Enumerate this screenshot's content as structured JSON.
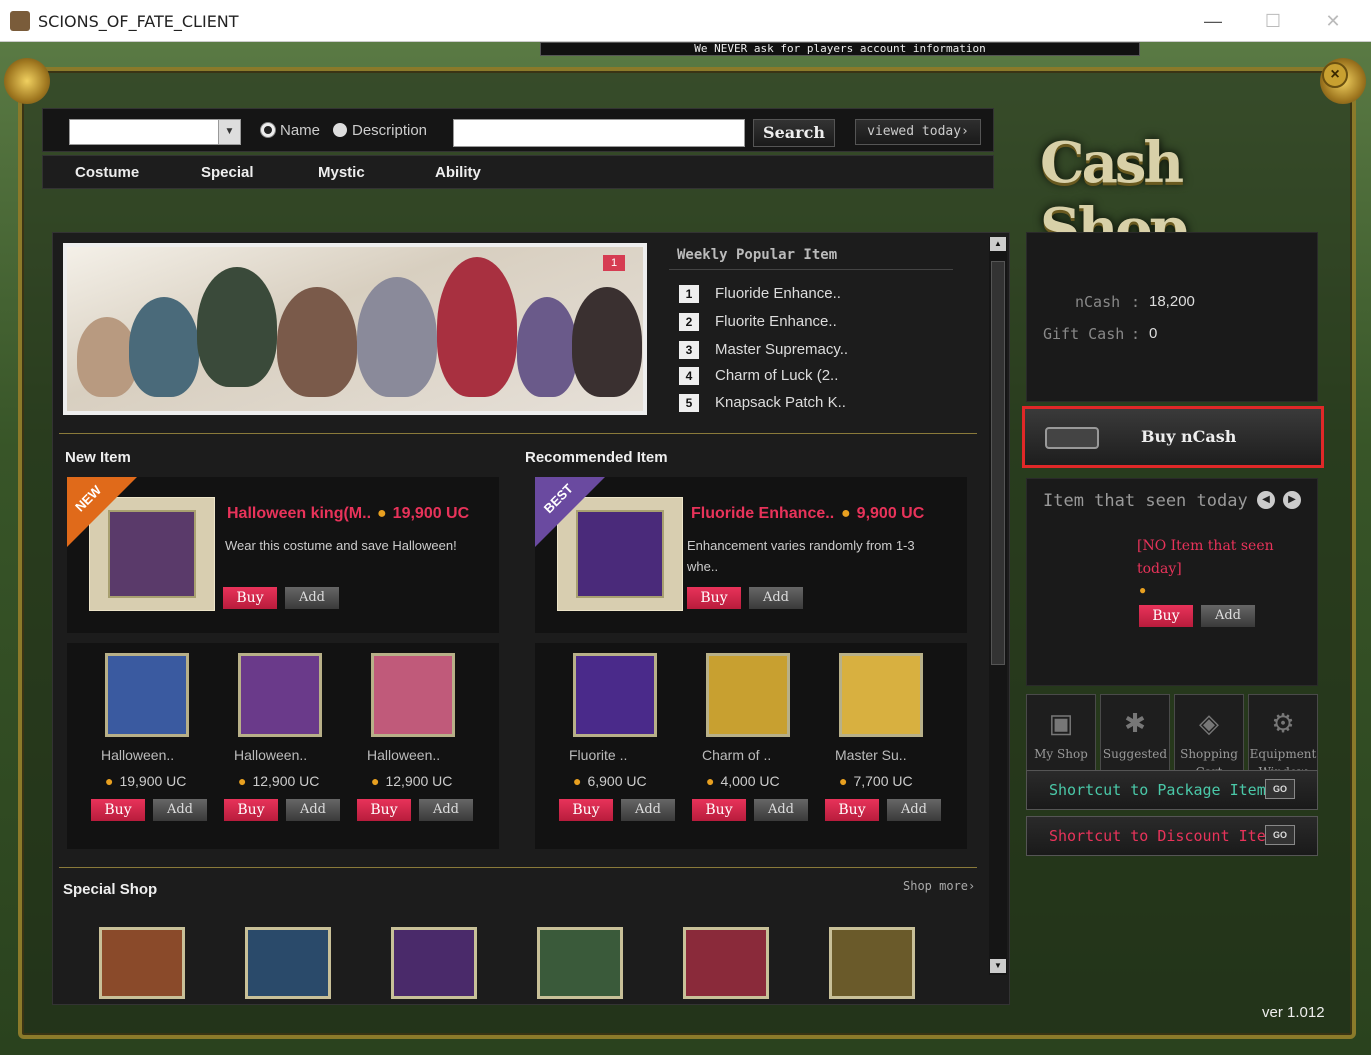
{
  "window": {
    "title": "SCIONS_OF_FATE_CLIENT",
    "minimize": "—",
    "maximize": "☐",
    "close": "✕"
  },
  "notice": "We NEVER ask for players account information",
  "search": {
    "category_value": "",
    "radio_name": "Name",
    "radio_description": "Description",
    "query_value": "",
    "search_label": "Search",
    "viewed_today_label": "viewed today›"
  },
  "categories": [
    "Costume",
    "Special",
    "Mystic",
    "Ability"
  ],
  "logo_text": "Cash Shop",
  "banner": {
    "page": "1"
  },
  "weekly": {
    "header": "Weekly Popular Item",
    "items": [
      {
        "rank": "1",
        "name": "Fluoride Enhance.."
      },
      {
        "rank": "2",
        "name": "Fluorite Enhance.."
      },
      {
        "rank": "3",
        "name": "Master Supremacy.."
      },
      {
        "rank": "4",
        "name": "Charm of Luck (2.."
      },
      {
        "rank": "5",
        "name": "Knapsack Patch K.."
      }
    ]
  },
  "new_item": {
    "title": "New Item",
    "featured": {
      "tag": "NEW",
      "name": "Halloween king(M..",
      "price": "19,900 UC",
      "desc": "Wear this costume and save Halloween!",
      "buy": "Buy",
      "add": "Add"
    },
    "grid": [
      {
        "name": "Halloween..",
        "price": "19,900 UC",
        "buy": "Buy",
        "add": "Add"
      },
      {
        "name": "Halloween..",
        "price": "12,900 UC",
        "buy": "Buy",
        "add": "Add"
      },
      {
        "name": "Halloween..",
        "price": "12,900 UC",
        "buy": "Buy",
        "add": "Add"
      }
    ]
  },
  "recommended": {
    "title": "Recommended Item",
    "featured": {
      "tag": "BEST",
      "name": "Fluoride Enhance..",
      "price": "9,900 UC",
      "desc": "Enhancement varies randomly from 1-3 whe..",
      "buy": "Buy",
      "add": "Add"
    },
    "grid": [
      {
        "name": "Fluorite ..",
        "price": "6,900 UC",
        "buy": "Buy",
        "add": "Add"
      },
      {
        "name": "Charm of ..",
        "price": "4,000 UC",
        "buy": "Buy",
        "add": "Add"
      },
      {
        "name": "Master Su..",
        "price": "7,700 UC",
        "buy": "Buy",
        "add": "Add"
      }
    ]
  },
  "special_shop": {
    "title": "Special Shop",
    "more": "Shop more›"
  },
  "balance": {
    "ncash_label": "nCash",
    "ncash_value": "18,200",
    "gift_label": "Gift Cash",
    "gift_value": "0",
    "sep": ":"
  },
  "buy_ncash": "Buy nCash",
  "seen_today": {
    "header": "Item that seen today",
    "empty": "[NO Item that seen today]",
    "buy": "Buy",
    "add": "Add"
  },
  "quick_links": [
    "My Shop",
    "Suggested",
    "Shopping Cart",
    "Equipment Window"
  ],
  "shortcuts": {
    "package": "Shortcut to Package Item",
    "discount": "Shortcut to Discount Item",
    "go": "GO"
  },
  "version": "ver 1.012",
  "colors": {
    "accent_pink": "#e8335a",
    "gold_frame": "#8b7a2a",
    "highlight_red": "#e02828",
    "panel_bg": "#1c1c1c"
  }
}
